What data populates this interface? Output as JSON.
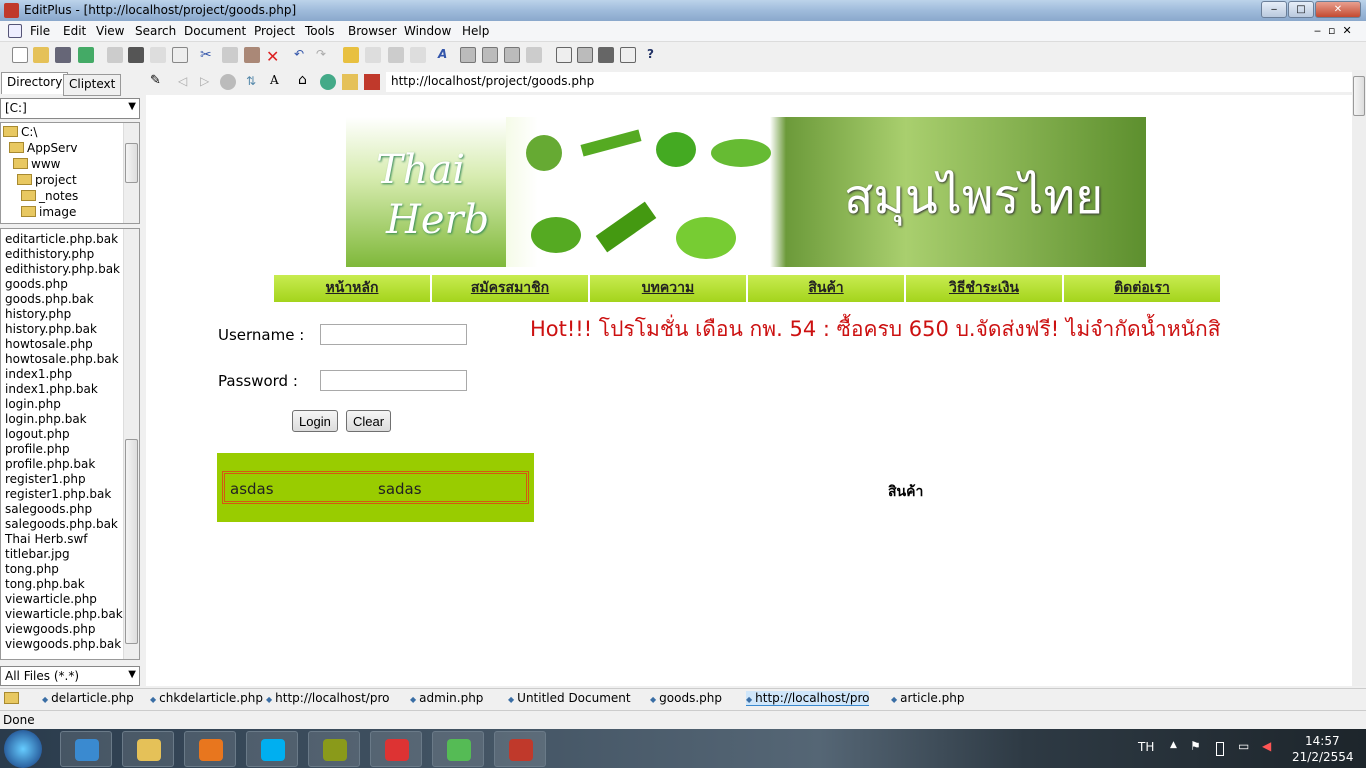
{
  "window": {
    "title": "EditPlus - [http://localhost/project/goods.php]"
  },
  "menu": [
    "File",
    "Edit",
    "View",
    "Search",
    "Document",
    "Project",
    "Tools",
    "Browser",
    "Window",
    "Help"
  ],
  "left_panel": {
    "tabs": [
      "Directory",
      "Cliptext"
    ],
    "drive": "[C:]",
    "tree": [
      "C:\\",
      "AppServ",
      "www",
      "project",
      "_notes",
      "image"
    ],
    "files": [
      "editarticle.php.bak",
      "edithistory.php",
      "edithistory.php.bak",
      "goods.php",
      "goods.php.bak",
      "history.php",
      "history.php.bak",
      "howtosale.php",
      "howtosale.php.bak",
      "index1.php",
      "index1.php.bak",
      "login.php",
      "login.php.bak",
      "logout.php",
      "profile.php",
      "profile.php.bak",
      "register1.php",
      "register1.php.bak",
      "salegoods.php",
      "salegoods.php.bak",
      "Thai Herb.swf",
      "titlebar.jpg",
      "tong.php",
      "tong.php.bak",
      "viewarticle.php",
      "viewarticle.php.bak",
      "viewgoods.php",
      "viewgoods.php.bak"
    ],
    "filter": "All Files (*.*)"
  },
  "browser": {
    "url": "http://localhost/project/goods.php"
  },
  "page": {
    "banner": {
      "logo_line1": "Thai",
      "logo_line2": "Herb",
      "title": "สมุนไพรไทย"
    },
    "nav": [
      "หน้าหลัก",
      "สมัครสมาชิก",
      "บทความ",
      "สินค้า",
      "วิธีชำระเงิน",
      "ติดต่อเรา"
    ],
    "login": {
      "username_label": "Username :",
      "password_label": "Password :",
      "username_value": "",
      "password_value": "",
      "login_button": "Login",
      "clear_button": "Clear"
    },
    "promo": "Hot!!! โปรโมชั่น เดือน กพ. 54 : ซื้อครบ 650 บ.จัดส่งฟรี! ไม่จำกัดน้ำหนักสิ",
    "box": {
      "col1": "asdas",
      "col2": "sadas"
    },
    "section_title": "สินค้า"
  },
  "doc_tabs": [
    {
      "label": "delarticle.php"
    },
    {
      "label": "chkdelarticle.php"
    },
    {
      "label": "http://localhost/pro"
    },
    {
      "label": "admin.php"
    },
    {
      "label": "Untitled Document"
    },
    {
      "label": "goods.php"
    },
    {
      "label": "http://localhost/pro",
      "active": true
    },
    {
      "label": "article.php"
    }
  ],
  "status": "Done",
  "taskbar": {
    "apps": [
      "start",
      "internet-explorer",
      "file-explorer",
      "media-player",
      "skype",
      "dreamweaver",
      "chrome",
      "messenger",
      "editplus"
    ],
    "lang": "TH",
    "time": "14:57",
    "date": "21/2/2554"
  },
  "colors": {
    "nav_green": "#a4d41c",
    "promo_red": "#cc1111",
    "box_green": "#99cc00",
    "box_border": "#d45a10"
  }
}
